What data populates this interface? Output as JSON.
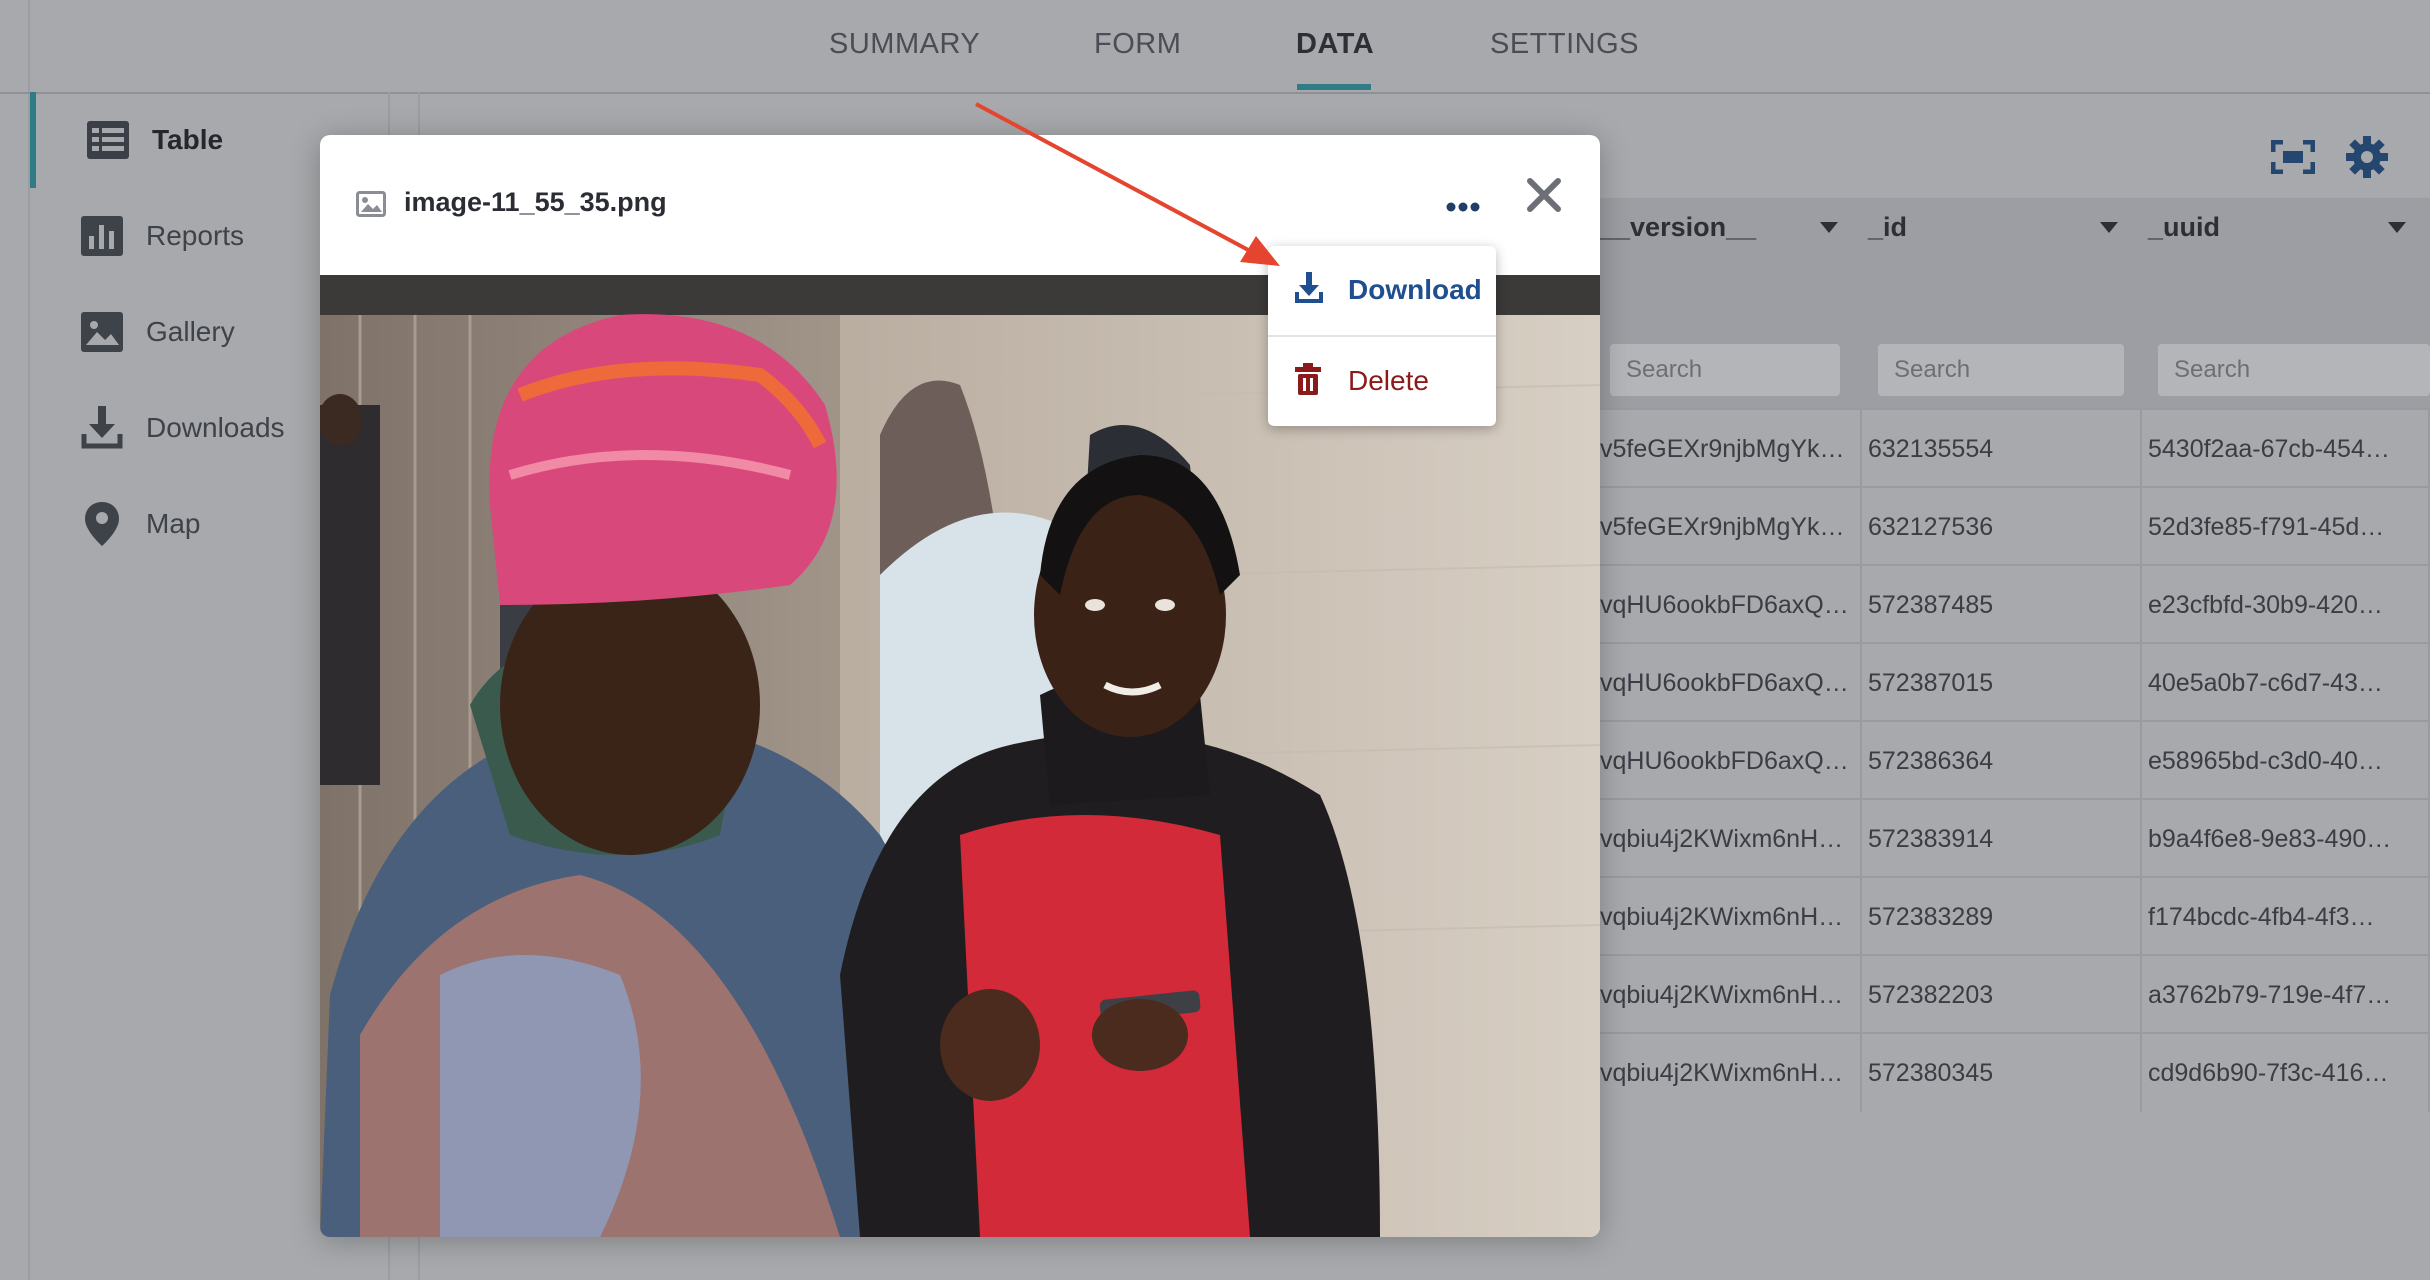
{
  "tabs": [
    "SUMMARY",
    "FORM",
    "DATA",
    "SETTINGS"
  ],
  "active_tab": "DATA",
  "sidebar": {
    "items": [
      {
        "label": "Table",
        "icon": "table-icon",
        "active": true
      },
      {
        "label": "Reports",
        "icon": "bar-chart-icon",
        "active": false
      },
      {
        "label": "Gallery",
        "icon": "image-icon",
        "active": false
      },
      {
        "label": "Downloads",
        "icon": "download-icon",
        "active": false
      },
      {
        "label": "Map",
        "icon": "map-pin-icon",
        "active": false
      }
    ]
  },
  "toolbar": {
    "fullscreen_icon": "fullscreen-icon",
    "settings_icon": "gear-icon"
  },
  "table": {
    "columns": [
      {
        "name": "__version__",
        "search_placeholder": "Search"
      },
      {
        "name": "_id",
        "search_placeholder": "Search"
      },
      {
        "name": "_uuid",
        "search_placeholder": "Search"
      }
    ],
    "rows": [
      [
        "v5feGEXr9njbMgYk…",
        "632135554",
        "5430f2aa-67cb-454…"
      ],
      [
        "v5feGEXr9njbMgYk…",
        "632127536",
        "52d3fe85-f791-45d…"
      ],
      [
        "vqHU6ookbFD6axQ…",
        "572387485",
        "e23cfbfd-30b9-420…"
      ],
      [
        "vqHU6ookbFD6axQ…",
        "572387015",
        "40e5a0b7-c6d7-43…"
      ],
      [
        "vqHU6ookbFD6axQ…",
        "572386364",
        "e58965bd-c3d0-40…"
      ],
      [
        "vqbiu4j2KWixm6nH…",
        "572383914",
        "b9a4f6e8-9e83-490…"
      ],
      [
        "vqbiu4j2KWixm6nH…",
        "572383289",
        "f174bcdc-4fb4-4f3…"
      ],
      [
        "vqbiu4j2KWixm6nH…",
        "572382203",
        "a3762b79-719e-4f7…"
      ],
      [
        "vqbiu4j2KWixm6nH…",
        "572380345",
        "cd9d6b90-7f3c-416…"
      ]
    ]
  },
  "modal": {
    "filename": "image-11_55_35.png",
    "file_icon": "image-file-icon",
    "more_icon": "more-horizontal-icon",
    "close_icon": "close-icon"
  },
  "menu": {
    "download_label": "Download",
    "delete_label": "Delete",
    "download_color": "#1f4f8f",
    "delete_color": "#8b1a1a"
  },
  "colors": {
    "accent": "#2f7c86",
    "arrow": "#e5452f"
  }
}
